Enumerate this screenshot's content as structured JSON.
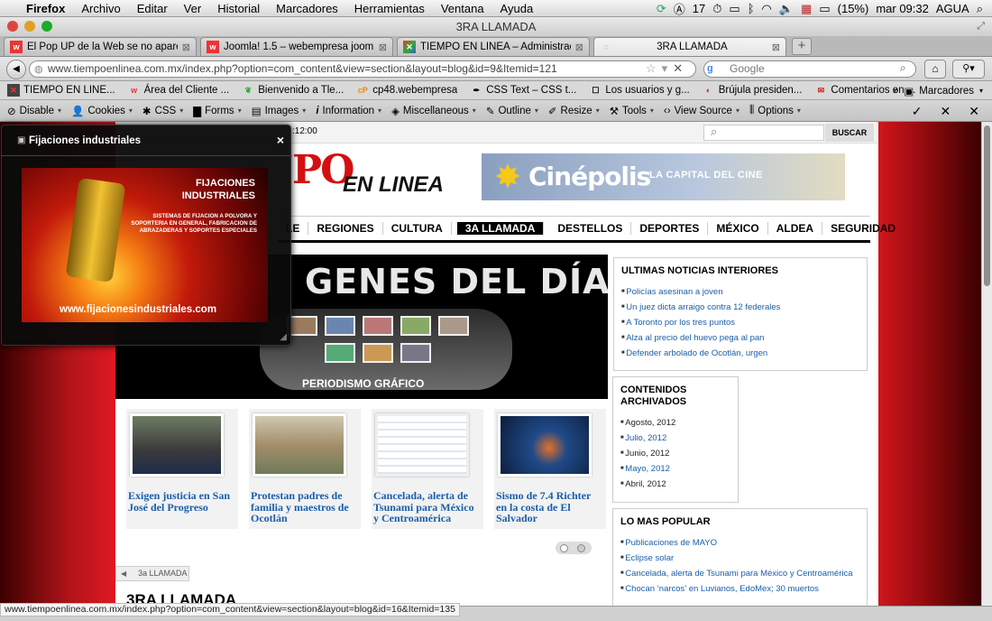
{
  "menubar": {
    "app": "Firefox",
    "items": [
      "Archivo",
      "Editar",
      "Ver",
      "Historial",
      "Marcadores",
      "Herramientas",
      "Ventana",
      "Ayuda"
    ],
    "badge_count": "17",
    "battery": "(15%)",
    "clock": "mar 09:32",
    "user": "AGUA"
  },
  "window": {
    "title": "3RA LLAMADA"
  },
  "tabs": [
    {
      "label": "El Pop UP de la Web se no apare..."
    },
    {
      "label": "Joomla! 1.5 – webempresa joom..."
    },
    {
      "label": "TIEMPO EN LINEA – Administrac..."
    },
    {
      "label": "3RA LLAMADA"
    }
  ],
  "newtab_label": "+",
  "nav": {
    "url": "www.tiempoenlinea.com.mx/index.php?option=com_content&view=section&layout=blog&id=9&Itemid=121",
    "search_placeholder": "Google",
    "search_engine_letter": "g"
  },
  "bookmarks": {
    "items": [
      "TIEMPO EN LINE...",
      "Área del Cliente ...",
      "Bienvenido a Tle...",
      "cp48.webempresa",
      "CSS Text – CSS t...",
      "Los usuarios y g...",
      "Brújula presiden...",
      "Comentarios en ..."
    ],
    "overflow": "»",
    "folder": "Marcadores"
  },
  "devtoolbar": {
    "items": [
      "Disable",
      "Cookies",
      "CSS",
      "Forms",
      "Images",
      "Information",
      "Miscellaneous",
      "Outline",
      "Resize",
      "Tools",
      "View Source",
      "Options"
    ]
  },
  "site": {
    "time": ":12:00",
    "search_button": "BUSCAR",
    "logo_main": "PO",
    "logo_sub": "EN LINEA",
    "banner_brand": "Cinépolis",
    "banner_tag": "LA CAPITAL DEL CINE",
    "nav": [
      "LE",
      "REGIONES",
      "CULTURA",
      "3A LLAMADA",
      "DESTELLOS",
      "DEPORTES",
      "MÉXICO",
      "ALDEA",
      "SEGURIDAD"
    ],
    "slider_title": "GENES DEL DÍA",
    "slider_sub": "PERIODISMO GRÁFICO",
    "news": [
      {
        "title": "Exigen justicia en San José del Progreso"
      },
      {
        "title": "Protestan padres de familia y maestros de Ocotlán"
      },
      {
        "title": "Cancelada, alerta de Tsunami para México y Centroamérica"
      },
      {
        "title": "Sismo de 7.4 Richter en la costa de El Salvador"
      }
    ],
    "breadcrumb": "3a LLAMADA",
    "section_title": "3RA LLAMADA",
    "ultimas": {
      "heading": "ULTIMAS NOTICIAS INTERIORES",
      "items": [
        "Policías asesinan a joven",
        "Un juez dicta arraigo contra 12 federales",
        "A Toronto por los tres puntos",
        "Alza al precio del huevo pega al pan",
        "Defender arbolado de Ocotlán, urgen"
      ]
    },
    "archivados": {
      "heading": "CONTENIDOS ARCHIVADOS",
      "items": [
        "Agosto, 2012",
        "Julio, 2012",
        "Junio, 2012",
        "Mayo, 2012",
        "Abril, 2012"
      ]
    },
    "popular": {
      "heading": "LO MAS POPULAR",
      "items": [
        "Publicaciones de MAYO",
        "Eclipse solar",
        "Cancelada, alerta de Tsunami para México y Centroamérica",
        "Chocan ‘narcos’ en Luvianos, EdoMex; 30 muertos"
      ]
    }
  },
  "popup": {
    "title": "Fijaciones industriales",
    "close": "×",
    "ad_heading": "FIJACIONES INDUSTRIALES",
    "ad_body": "SISTEMAS DE FIJACION A POLVORA Y SOPORTERIA EN GENERAL, FABRICACION DE ABRAZADERAS Y SOPORTES ESPECIALES",
    "ad_url": "www.fijacionesindustriales.com"
  },
  "status": {
    "url": "www.tiempoenlinea.com.mx/index.php?option=com_content&view=section&layout=blog&id=16&Itemid=135"
  },
  "colors": {
    "accent_red": "#d40f10",
    "link_blue": "#1a5ea8",
    "nav_active": "#000000"
  }
}
